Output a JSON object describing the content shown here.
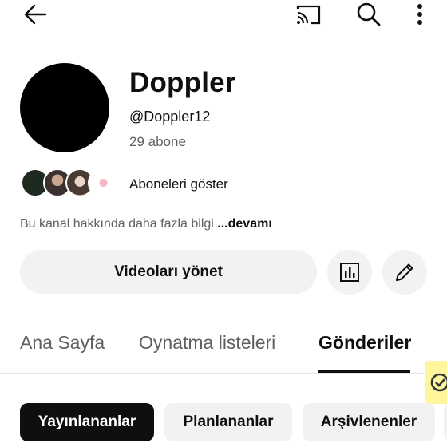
{
  "header": {
    "icons": [
      "back-arrow-icon",
      "cast-icon",
      "search-icon",
      "more-vertical-icon"
    ]
  },
  "channel": {
    "name": "Doppler",
    "handle": "@Doppler12",
    "subscribers": "29 abone",
    "show_subscribers": "Aboneleri göster",
    "about_text": "Bu kanal hakkında daha fazla bilgi ",
    "about_more": "...devamı"
  },
  "actions": {
    "manage_videos": "Videoları yönet",
    "stats_icon": "analytics-icon",
    "edit_icon": "pencil-icon"
  },
  "tabs": [
    {
      "label": "Ana Sayfa",
      "selected": false
    },
    {
      "label": "Oynatma listeleri",
      "selected": false
    },
    {
      "label": "Gönderiler",
      "selected": true
    }
  ],
  "chips": [
    {
      "label": "Yayınlananlar",
      "selected": true
    },
    {
      "label": "Planlananlar",
      "selected": false
    },
    {
      "label": "Arşivlenenler",
      "selected": false
    }
  ],
  "colors": {
    "text": "#0f0f0f",
    "secondary_text": "#606060",
    "chip_bg": "#f2f2f2",
    "badge": "#fff59d"
  }
}
